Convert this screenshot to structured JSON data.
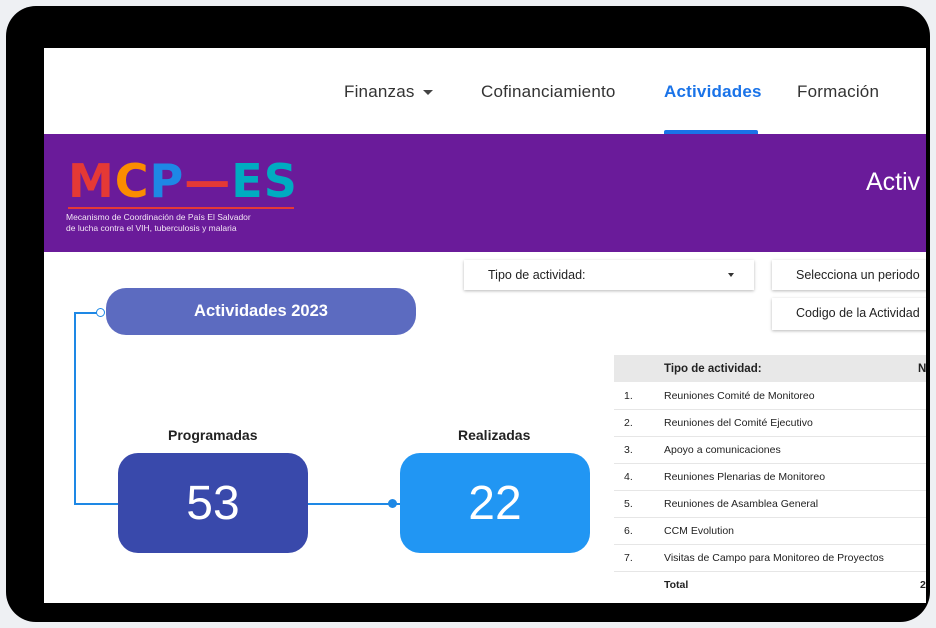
{
  "nav": {
    "items": [
      {
        "label": "Finanzas",
        "has_dropdown": true,
        "active": false
      },
      {
        "label": "Cofinanciamiento",
        "active": false
      },
      {
        "label": "Actividades",
        "active": true
      },
      {
        "label": "Formación",
        "active": false
      }
    ]
  },
  "banner": {
    "logo_letters": [
      "M",
      "C",
      "P",
      "—",
      "E",
      "S"
    ],
    "logo_colors": [
      "#e53935",
      "#fb8c00",
      "#1e88e5",
      "#e53935",
      "#00acc1",
      "#00acc1"
    ],
    "logo_subtitle_line1": "Mecanismo de Coordinación de País El Salvador",
    "logo_subtitle_line2": "de lucha contra el VIH, tuberculosis y malaria",
    "title_partial": "Activ"
  },
  "filters": {
    "tipo_actividad": "Tipo de actividad:",
    "periodo": "Selecciona un periodo",
    "codigo": "Codigo de la Actividad"
  },
  "summary": {
    "title": "Actividades 2023",
    "programadas_label": "Programadas",
    "programadas_value": "53",
    "realizadas_label": "Realizadas",
    "realizadas_value": "22"
  },
  "table": {
    "header_tipo": "Tipo de actividad:",
    "header_n": "N",
    "rows": [
      {
        "num": "1.",
        "label": "Reuniones Comité de Monitoreo",
        "value": ""
      },
      {
        "num": "2.",
        "label": "Reuniones del Comité Ejecutivo",
        "value": ""
      },
      {
        "num": "3.",
        "label": "Apoyo a comunicaciones",
        "value": ""
      },
      {
        "num": "4.",
        "label": "Reuniones Plenarias de Monitoreo",
        "value": ""
      },
      {
        "num": "5.",
        "label": "Reuniones de Asamblea General",
        "value": ""
      },
      {
        "num": "6.",
        "label": "CCM Evolution",
        "value": ""
      },
      {
        "num": "7.",
        "label": "Visitas de Campo para Monitoreo de Proyectos",
        "value": ""
      }
    ],
    "total_label": "Total",
    "total_value": "2"
  },
  "colors": {
    "banner": "#6a1b9a",
    "accent": "#1a73e8",
    "pill": "#5c6bc0",
    "programadas_box": "#3949ab",
    "realizadas_box": "#2196f3",
    "connector": "#1e88e5"
  }
}
